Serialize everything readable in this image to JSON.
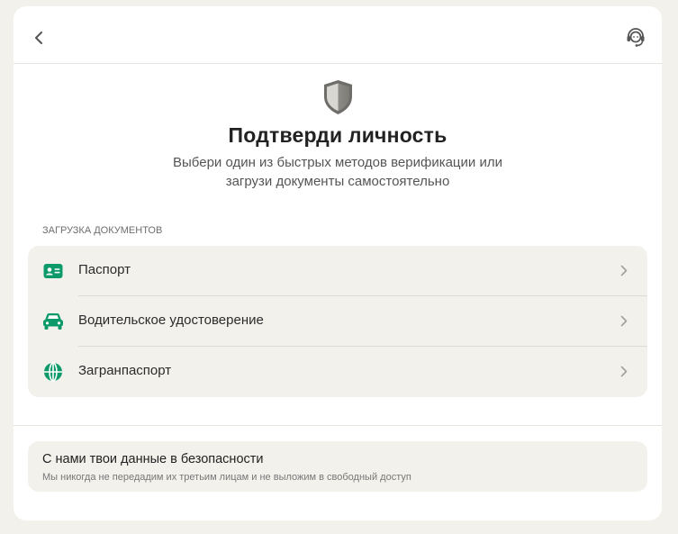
{
  "colors": {
    "accent": "#0d9a6a",
    "background": "#f3f1ec",
    "card": "#ffffff",
    "muted_text": "#777777"
  },
  "header": {
    "back_icon": "chevron-left-icon",
    "support_icon": "headset-support-icon"
  },
  "hero": {
    "icon": "shield-icon",
    "title": "Подтверди личность",
    "subtitle": "Выбери один из быстрых методов верификации или загрузи документы самостоятельно"
  },
  "documents": {
    "section_label": "ЗАГРУЗКА ДОКУМЕНТОВ",
    "items": [
      {
        "label": "Паспорт",
        "icon": "id-card-icon"
      },
      {
        "label": "Водительское удостоверение",
        "icon": "car-icon"
      },
      {
        "label": "Загранпаспорт",
        "icon": "globe-icon"
      }
    ]
  },
  "safety": {
    "title": "С нами твои данные в безопасности",
    "text": "Мы никогда не передадим их третьим лицам и не выложим в свободный доступ"
  }
}
